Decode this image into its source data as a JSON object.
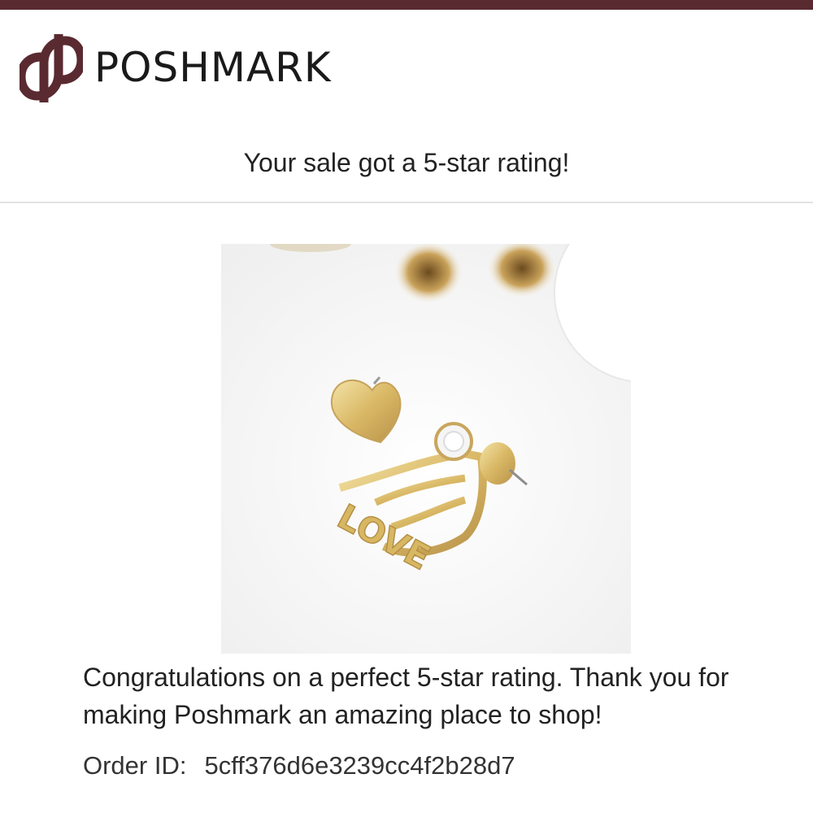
{
  "brand": {
    "name": "POSHMARK",
    "color": "#5a2a31",
    "icon": "poshmark-logo-icon"
  },
  "email": {
    "headline": "Your sale got a 5-star rating!",
    "message": "Congratulations on a perfect 5-star rating. Thank you for making Poshmark an amazing place to shop!",
    "order_label": "Order ID:",
    "order_id": "5cff376d6e3239cc4f2b28d7"
  },
  "product": {
    "image": "gold-love-heart-earrings-photo"
  }
}
